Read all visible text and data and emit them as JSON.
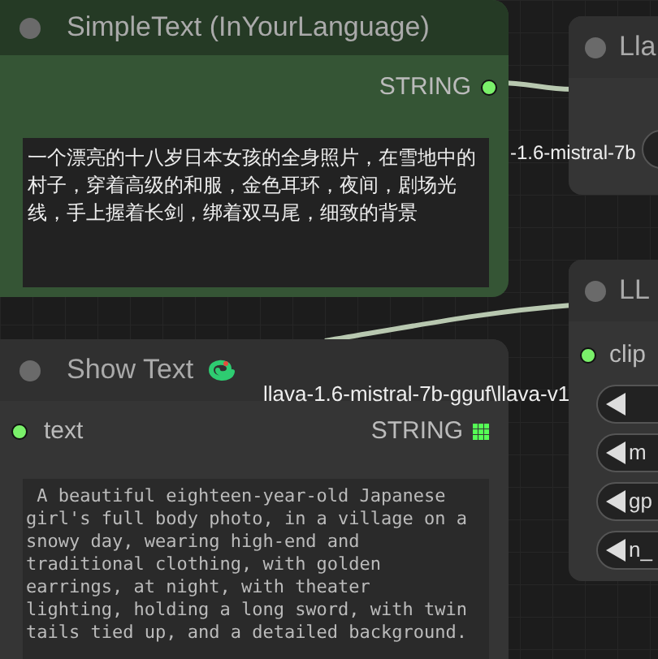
{
  "simple_text_node": {
    "title": "SimpleText (InYourLanguage)",
    "output": {
      "label": "STRING",
      "connected": true
    },
    "text": "一个漂亮的十八岁日本女孩的全身照片，在雪地中的村子，穿着高级的和服，金色耳环，夜间，剧场光线，手上握着长剑，绑着双马尾，细致的背景"
  },
  "show_text_node": {
    "title": "Show Text",
    "input": {
      "label": "text",
      "connected": true
    },
    "output": {
      "label": "STRING"
    },
    "text": " A beautiful eighteen-year-old Japanese girl's full body photo, in a village on a snowy day, wearing high-end and traditional clothing, with golden earrings, at night, with theater lighting, holding a long sword, with twin tails tied up, and a detailed background."
  },
  "loader_node": {
    "title": "Lla",
    "floating_label": "-1.6-mistral-7b"
  },
  "llava_node": {
    "title": "LL",
    "input": {
      "label": "clip",
      "connected": true
    },
    "widgets": [
      {
        "value": "m"
      },
      {
        "value": "gp"
      },
      {
        "value": "n_"
      }
    ],
    "floating_label": "llava-1.6-mistral-7b-gguf\\llava-v1"
  }
}
